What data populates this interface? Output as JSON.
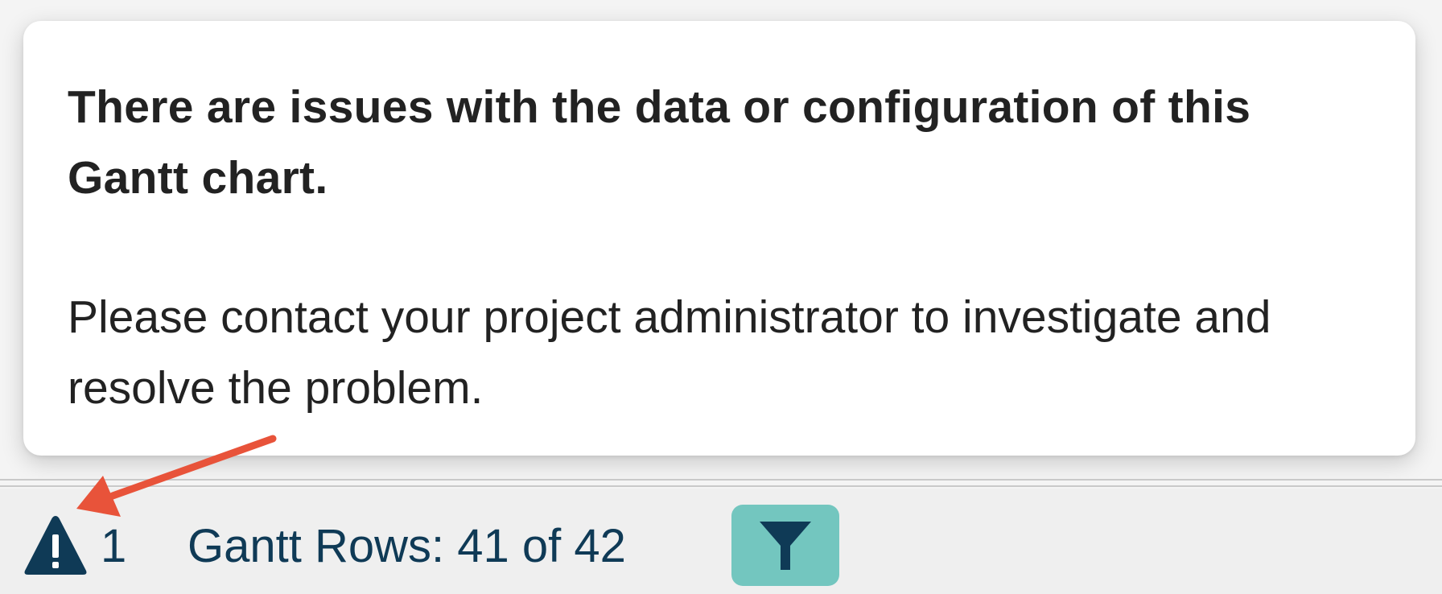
{
  "popover": {
    "title": "There are issues with the data or configuration of this Gantt chart.",
    "body": "Please contact your project administrator to investigate and resolve the problem."
  },
  "statusbar": {
    "warning_icon": "warning-triangle-icon",
    "warning_count": "1",
    "rows_label": "Gantt Rows: 41 of 42",
    "filter_icon": "filter-funnel-icon"
  },
  "colors": {
    "popover_bg": "#ffffff",
    "page_bg": "#f4f4f4",
    "statusbar_text": "#0f3a56",
    "filter_button_bg": "#73c6bf",
    "annotation_arrow": "#e8533a"
  }
}
